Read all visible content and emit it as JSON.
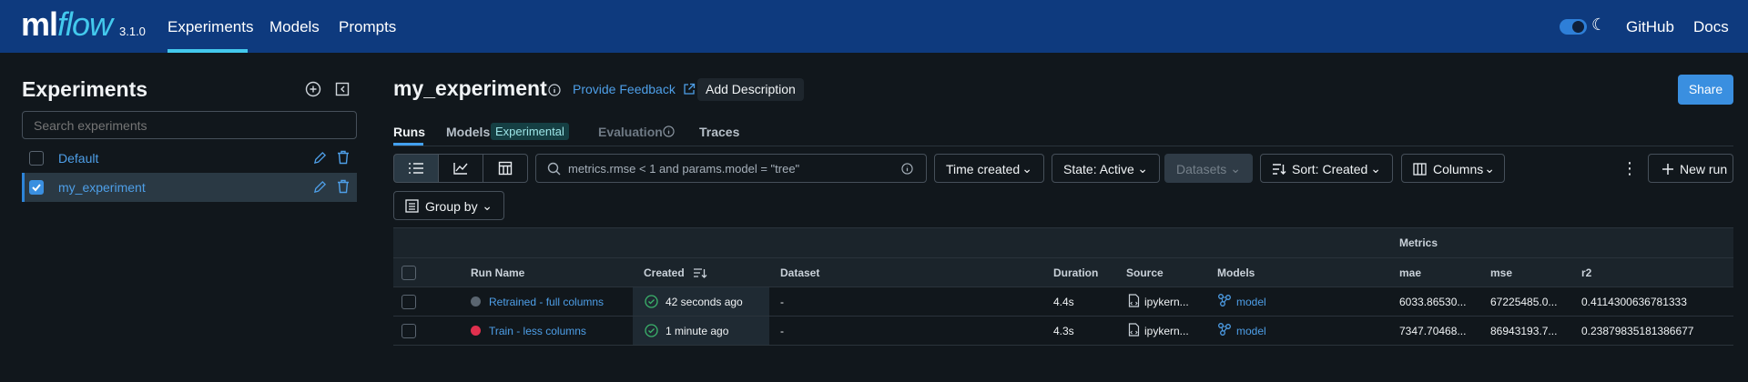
{
  "app": {
    "logo_main": "ml",
    "logo_flow": "flow",
    "version": "3.1.0",
    "nav": [
      "Experiments",
      "Models",
      "Prompts"
    ],
    "top_links": [
      "GitHub",
      "Docs"
    ]
  },
  "sidebar": {
    "title": "Experiments",
    "search_placeholder": "Search experiments",
    "items": [
      {
        "label": "Default",
        "checked": false
      },
      {
        "label": "my_experiment",
        "checked": true
      }
    ]
  },
  "header": {
    "title": "my_experiment",
    "feedback": "Provide Feedback",
    "add_description": "Add Description",
    "share": "Share"
  },
  "tabs": {
    "runs": "Runs",
    "models": "Models",
    "experimental_badge": "Experimental",
    "evaluation": "Evaluation",
    "traces": "Traces"
  },
  "toolbar": {
    "filter_text": "metrics.rmse < 1 and params.model = \"tree\"",
    "time_created": "Time created",
    "state": "State: Active",
    "datasets": "Datasets",
    "sort": "Sort: Created",
    "columns": "Columns",
    "new_run": "New run",
    "group_by": "Group by"
  },
  "table": {
    "group_header": "Metrics",
    "columns": [
      "Run Name",
      "Created",
      "Dataset",
      "Duration",
      "Source",
      "Models",
      "mae",
      "mse",
      "r2"
    ],
    "rows": [
      {
        "run_name": "Retrained - full columns",
        "created": "42 seconds ago",
        "dataset": "-",
        "duration": "4.4s",
        "source": "ipykern...",
        "model": "model",
        "mae": "6033.86530...",
        "mse": "67225485.0...",
        "r2": "0.4114300636781333",
        "color": "#5a6570"
      },
      {
        "run_name": "Train - less columns",
        "created": "1 minute ago",
        "dataset": "-",
        "duration": "4.3s",
        "source": "ipykern...",
        "model": "model",
        "mae": "7347.70468...",
        "mse": "86943193.7...",
        "r2": "0.23879835181386677",
        "color": "#e0304e"
      }
    ]
  },
  "colors": {
    "topbar": "#0e3a7e",
    "accent": "#43c9ed",
    "link": "#4e9fe8",
    "primary": "#3a8fe0",
    "success": "#3bb36b"
  }
}
